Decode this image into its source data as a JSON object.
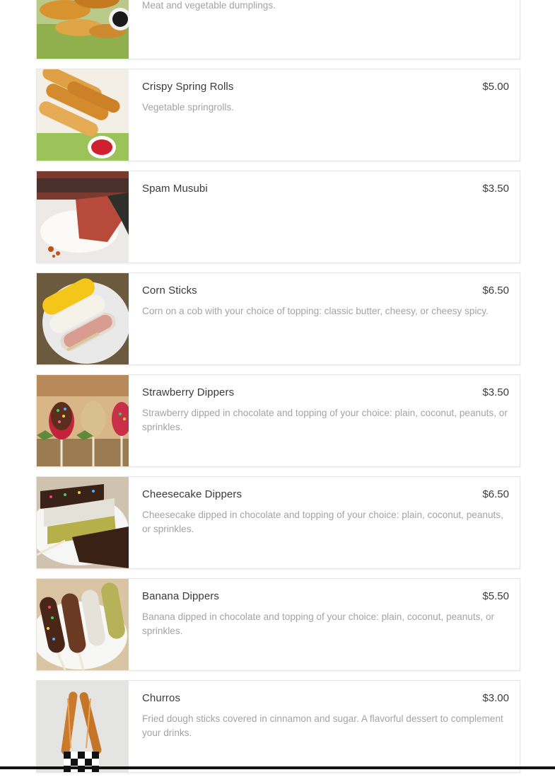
{
  "menu": {
    "items": [
      {
        "name": "",
        "price": "",
        "description": "Meat and vegetable dumplings.",
        "image": "dumplings-photo"
      },
      {
        "name": "Crispy Spring Rolls",
        "price": "$5.00",
        "description": "Vegetable springrolls.",
        "image": "spring-rolls-photo"
      },
      {
        "name": "Spam Musubi",
        "price": "$3.50",
        "description": "",
        "image": "spam-musubi-photo"
      },
      {
        "name": "Corn Sticks",
        "price": "$6.50",
        "description": "Corn on a cob with your choice of topping: classic butter, cheesy, or cheesy spicy.",
        "image": "corn-sticks-photo"
      },
      {
        "name": "Strawberry Dippers",
        "price": "$3.50",
        "description": "Strawberry dipped in chocolate and topping of your choice: plain, coconut, peanuts, or sprinkles.",
        "image": "strawberry-dippers-photo"
      },
      {
        "name": "Cheesecake Dippers",
        "price": "$6.50",
        "description": "Cheesecake dipped in chocolate and topping of your choice: plain, coconut, peanuts, or sprinkles.",
        "image": "cheesecake-dippers-photo"
      },
      {
        "name": "Banana Dippers",
        "price": "$5.50",
        "description": "Banana dipped in chocolate and topping of your choice: plain, coconut, peanuts, or sprinkles.",
        "image": "banana-dippers-photo"
      },
      {
        "name": "Churros",
        "price": "$3.00",
        "description": "Fried dough sticks covered in cinnamon and sugar. A flavorful dessert to complement your drinks.",
        "image": "churros-photo"
      }
    ]
  },
  "colors": {
    "name_text": "#3a3a3a",
    "description_text": "#a3a3a3",
    "card_border": "#e6e6e6",
    "bottom_bar": "#111111"
  }
}
